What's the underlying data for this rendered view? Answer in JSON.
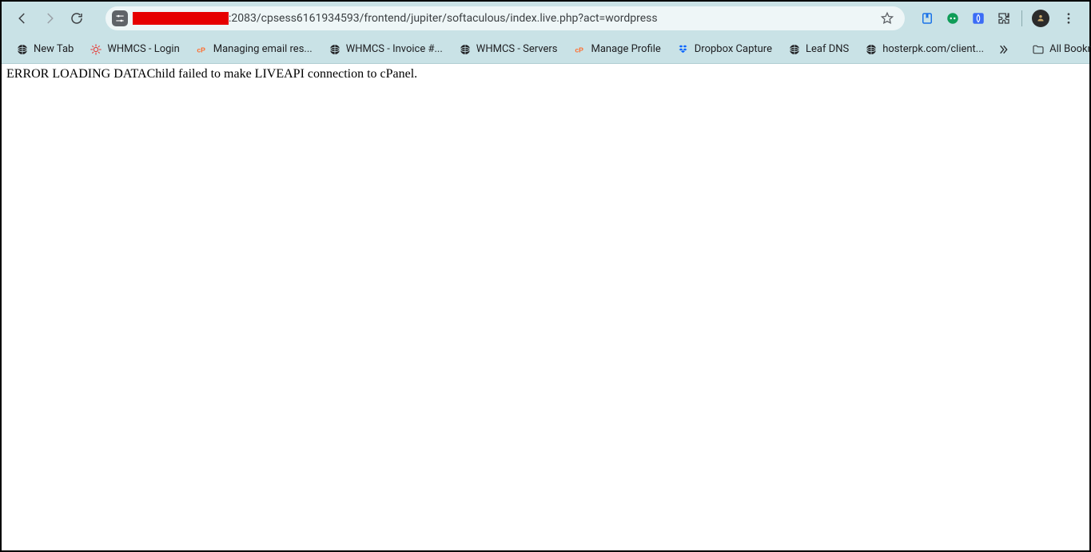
{
  "toolbar": {
    "url_suffix": ":2083/cpsess6161934593/frontend/jupiter/softaculous/index.live.php?act=wordpress"
  },
  "bookmarks": {
    "items": [
      {
        "label": "New Tab",
        "icon": "globe"
      },
      {
        "label": "WHMCS - Login",
        "icon": "gear-red"
      },
      {
        "label": "Managing email res...",
        "icon": "cp"
      },
      {
        "label": "WHMCS - Invoice #...",
        "icon": "globe"
      },
      {
        "label": "WHMCS - Servers",
        "icon": "globe"
      },
      {
        "label": "Manage Profile",
        "icon": "cp"
      },
      {
        "label": "Dropbox Capture",
        "icon": "dropbox"
      },
      {
        "label": "Leaf DNS",
        "icon": "globe"
      },
      {
        "label": "hosterpk.com/client...",
        "icon": "globe"
      }
    ],
    "all_label": "All Bookmarks"
  },
  "page": {
    "error_text": "ERROR LOADING DATAChild failed to make LIVEAPI connection to cPanel."
  }
}
